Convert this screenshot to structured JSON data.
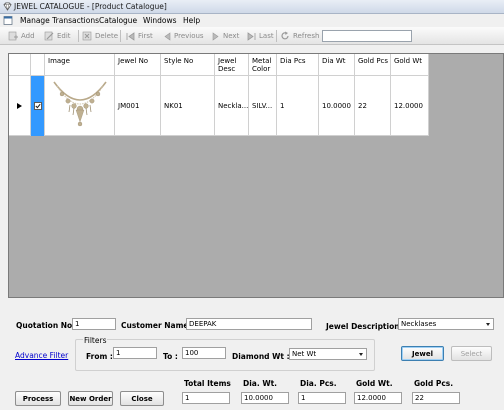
{
  "window": {
    "title": "JEWEL CATALOGUE - [Product Catalogue]"
  },
  "menu": [
    "Manage Transactions",
    "Catalogue",
    "Windows",
    "Help"
  ],
  "toolbar": {
    "add": "Add",
    "edit": "Edit",
    "delete": "Delete",
    "first": "First",
    "previous": "Previous",
    "next": "Next",
    "last": "Last",
    "refresh": "Refresh",
    "search_value": ""
  },
  "grid": {
    "headers": [
      "Image",
      "Jewel No",
      "Style No",
      "Jewel Desc",
      "Metal Color",
      "Dia Pcs",
      "Dia Wt",
      "Gold Pcs",
      "Gold Wt"
    ],
    "rows": [
      {
        "checked": true,
        "jewel_no": "JM001",
        "style_no": "NK01",
        "jewel_desc": "Neckla...",
        "metal_color": "SILV...",
        "dia_pcs": "1",
        "dia_wt": "10.0000",
        "gold_pcs": "22",
        "gold_wt": "12.0000"
      }
    ]
  },
  "form": {
    "quotation_label": "Quotation No :",
    "quotation_value": "1",
    "customer_label": "Customer Name :",
    "customer_value": "DEEPAK",
    "jewel_desc_label": "Jewel Description :",
    "jewel_desc_value": "Necklases",
    "advance_filter": "Advance Filter",
    "filters_label": "Filters",
    "from_label": "From :",
    "from_value": "1",
    "to_label": "To :",
    "to_value": "100",
    "diamond_wt_label": "Diamond Wt :",
    "diamond_wt_value": "Net Wt",
    "jewel_button": "Jewel",
    "select_button": "Select",
    "process_button": "Process",
    "new_order_button": "New Order",
    "close_button": "Close",
    "total_items_label": "Total Items",
    "total_items_value": "1",
    "dia_wt_label": "Dia. Wt.",
    "dia_wt_value": "10.0000",
    "dia_pcs_label": "Dia. Pcs.",
    "dia_pcs_value": "1",
    "gold_wt_label": "Gold Wt.",
    "gold_wt_value": "12.0000",
    "gold_pcs_label": "Gold Pcs.",
    "gold_pcs_value": "22"
  },
  "colors": {
    "selection": "#3399ff",
    "grid_background": "#acacac",
    "link": "#0000cc"
  }
}
